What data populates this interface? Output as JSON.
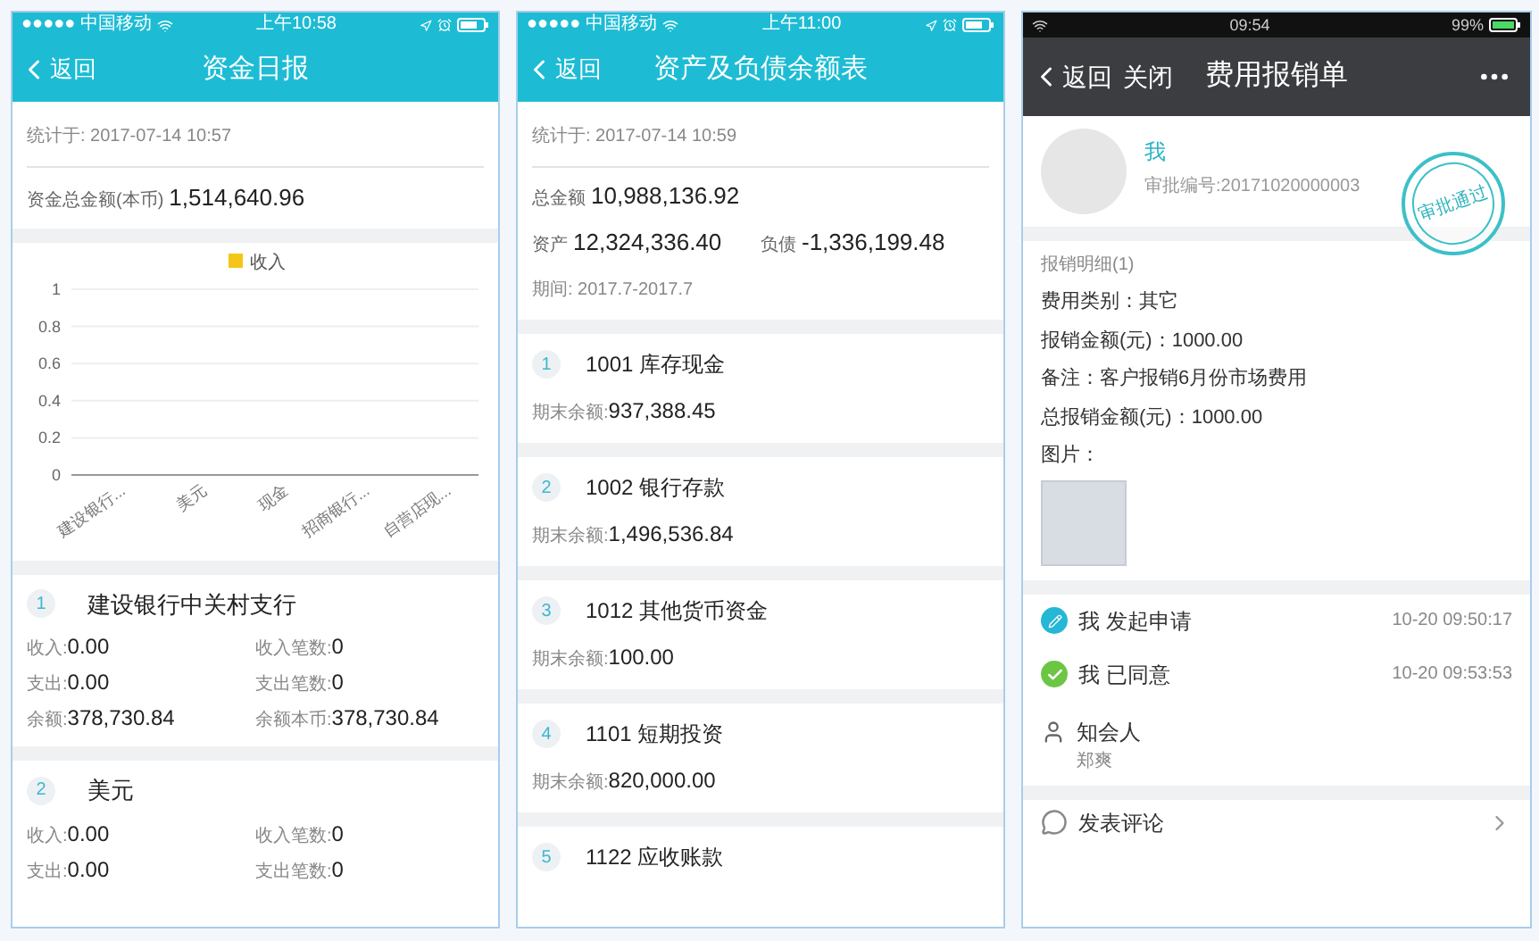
{
  "daily_report": {
    "status_bar": {
      "carrier": "●●●●● 中国移动",
      "time": "上午10:58"
    },
    "nav": {
      "back": "返回",
      "title": "资金日报"
    },
    "stat_time": "统计于: 2017-07-14 10:57",
    "total": {
      "label": "资金总金额(本币)",
      "value": "1,514,640.96"
    },
    "chart_data": {
      "type": "bar",
      "categories": [
        "建设银行...",
        "美元",
        "现金",
        "招商银行...",
        "自营店现..."
      ],
      "series": [
        {
          "name": "收入",
          "color": "#f5c518",
          "values": [
            0,
            0,
            0,
            0,
            0
          ]
        }
      ],
      "grid": true,
      "ylim": [
        0,
        1
      ],
      "yticks": [
        0,
        0.2,
        0.4,
        0.6,
        0.8,
        1
      ]
    },
    "accounts": [
      {
        "index": "1",
        "name": "建设银行中关村支行",
        "fields": [
          {
            "label": "收入:",
            "value": "0.00"
          },
          {
            "label": "收入笔数:",
            "value": "0"
          },
          {
            "label": "支出:",
            "value": "0.00"
          },
          {
            "label": "支出笔数:",
            "value": "0"
          },
          {
            "label": "余额:",
            "value": "378,730.84"
          },
          {
            "label": "余额本币:",
            "value": "378,730.84"
          }
        ]
      },
      {
        "index": "2",
        "name": "美元",
        "fields": [
          {
            "label": "收入:",
            "value": "0.00"
          },
          {
            "label": "收入笔数:",
            "value": "0"
          },
          {
            "label": "支出:",
            "value": "0.00"
          },
          {
            "label": "支出笔数:",
            "value": "0"
          }
        ]
      }
    ]
  },
  "balance_sheet": {
    "status_bar": {
      "carrier": "●●●●● 中国移动",
      "time": "上午11:00"
    },
    "nav": {
      "back": "返回",
      "title": "资产及负债余额表"
    },
    "stat_time": "统计于: 2017-07-14 10:59",
    "total": {
      "label": "总金额",
      "value": "10,988,136.92"
    },
    "assets": {
      "label": "资产",
      "value": "12,324,336.40"
    },
    "liabilities": {
      "label": "负债",
      "value": "-1,336,199.48"
    },
    "period": "期间: 2017.7-2017.7",
    "accounts": [
      {
        "index": "1",
        "title": "1001 库存现金",
        "balance_label": "期末余额:",
        "balance": "937,388.45"
      },
      {
        "index": "2",
        "title": "1002 银行存款",
        "balance_label": "期末余额:",
        "balance": "1,496,536.84"
      },
      {
        "index": "3",
        "title": "1012 其他货币资金",
        "balance_label": "期末余额:",
        "balance": "100.00"
      },
      {
        "index": "4",
        "title": "1101 短期投资",
        "balance_label": "期末余额:",
        "balance": "820,000.00"
      },
      {
        "index": "5",
        "title": "1122 应收账款"
      }
    ]
  },
  "expense_form": {
    "status_bar": {
      "time": "09:54",
      "battery": "99%"
    },
    "nav": {
      "back": "返回",
      "close": "关闭",
      "title": "费用报销单"
    },
    "applicant": {
      "name": "我",
      "number": "审批编号:20171020000003"
    },
    "stamp": "审批通过",
    "detail_title": "报销明细(1)",
    "fields": [
      {
        "label": "费用类别：",
        "value": "其它"
      },
      {
        "label": "报销金额(元)：",
        "value": "1000.00"
      },
      {
        "label": "备注：",
        "value": "客户报销6月份市场费用"
      },
      {
        "label": "总报销金额(元)：",
        "value": "1000.00"
      }
    ],
    "images_label": "图片：",
    "timeline": [
      {
        "kind": "submitted",
        "text": "我 发起申请",
        "time": "10-20 09:50:17"
      },
      {
        "kind": "approved",
        "text": "我 已同意",
        "time": "10-20 09:53:53"
      }
    ],
    "cc": {
      "label": "知会人",
      "names": "郑爽"
    },
    "comment": {
      "label": "发表评论"
    }
  }
}
